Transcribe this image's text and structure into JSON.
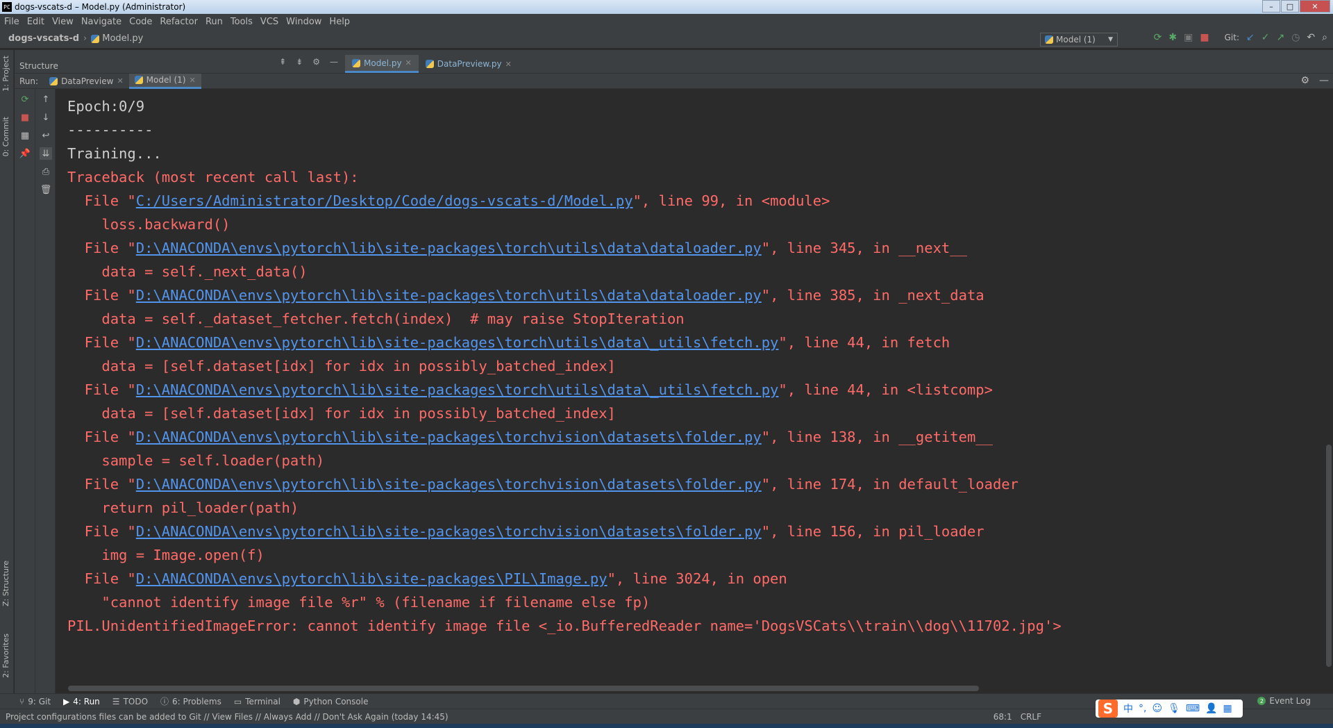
{
  "window": {
    "title": "dogs-vscats-d – Model.py (Administrator)",
    "app_icon": "PC",
    "controls": [
      "–",
      "□",
      "✕"
    ]
  },
  "menu": [
    "File",
    "Edit",
    "View",
    "Navigate",
    "Code",
    "Refactor",
    "Run",
    "Tools",
    "VCS",
    "Window",
    "Help"
  ],
  "nav": {
    "project": "dogs-vscats-d",
    "file": "Model.py",
    "run_config": "Model (1)",
    "git_label": "Git:"
  },
  "structure_panel": {
    "label": "Structure"
  },
  "editor_tabs": [
    {
      "label": "Model.py",
      "active": true
    },
    {
      "label": "DataPreview.py",
      "active": false
    }
  ],
  "run_panel": {
    "label": "Run:",
    "tabs": [
      {
        "label": "DataPreview",
        "active": false
      },
      {
        "label": "Model (1)",
        "active": true
      }
    ]
  },
  "left_vertical_tabs": {
    "project": "1: Project",
    "commit": "0: Commit",
    "structure": "Z: Structure",
    "favorites": "2: Favorites"
  },
  "console": {
    "lines": [
      {
        "type": "std",
        "text": "Epoch:0/9"
      },
      {
        "type": "std",
        "text": "----------"
      },
      {
        "type": "std",
        "text": "Training..."
      },
      {
        "type": "err",
        "text": "Traceback (most recent call last):"
      },
      {
        "type": "file",
        "pre": "  File \"",
        "path": "C:/Users/Administrator/Desktop/Code/dogs-vscats-d/Model.py",
        "post": "\", line 99, in <module>"
      },
      {
        "type": "err",
        "text": "    loss.backward()"
      },
      {
        "type": "file",
        "pre": "  File \"",
        "path": "D:\\ANACONDA\\envs\\pytorch\\lib\\site-packages\\torch\\utils\\data\\dataloader.py",
        "post": "\", line 345, in __next__"
      },
      {
        "type": "err",
        "text": "    data = self._next_data()"
      },
      {
        "type": "file",
        "pre": "  File \"",
        "path": "D:\\ANACONDA\\envs\\pytorch\\lib\\site-packages\\torch\\utils\\data\\dataloader.py",
        "post": "\", line 385, in _next_data"
      },
      {
        "type": "err",
        "text": "    data = self._dataset_fetcher.fetch(index)  # may raise StopIteration"
      },
      {
        "type": "file",
        "pre": "  File \"",
        "path": "D:\\ANACONDA\\envs\\pytorch\\lib\\site-packages\\torch\\utils\\data\\_utils\\fetch.py",
        "post": "\", line 44, in fetch"
      },
      {
        "type": "err",
        "text": "    data = [self.dataset[idx] for idx in possibly_batched_index]"
      },
      {
        "type": "file",
        "pre": "  File \"",
        "path": "D:\\ANACONDA\\envs\\pytorch\\lib\\site-packages\\torch\\utils\\data\\_utils\\fetch.py",
        "post": "\", line 44, in <listcomp>"
      },
      {
        "type": "err",
        "text": "    data = [self.dataset[idx] for idx in possibly_batched_index]"
      },
      {
        "type": "file",
        "pre": "  File \"",
        "path": "D:\\ANACONDA\\envs\\pytorch\\lib\\site-packages\\torchvision\\datasets\\folder.py",
        "post": "\", line 138, in __getitem__"
      },
      {
        "type": "err",
        "text": "    sample = self.loader(path)"
      },
      {
        "type": "file",
        "pre": "  File \"",
        "path": "D:\\ANACONDA\\envs\\pytorch\\lib\\site-packages\\torchvision\\datasets\\folder.py",
        "post": "\", line 174, in default_loader"
      },
      {
        "type": "err",
        "text": "    return pil_loader(path)"
      },
      {
        "type": "file",
        "pre": "  File \"",
        "path": "D:\\ANACONDA\\envs\\pytorch\\lib\\site-packages\\torchvision\\datasets\\folder.py",
        "post": "\", line 156, in pil_loader"
      },
      {
        "type": "err",
        "text": "    img = Image.open(f)"
      },
      {
        "type": "file",
        "pre": "  File \"",
        "path": "D:\\ANACONDA\\envs\\pytorch\\lib\\site-packages\\PIL\\Image.py",
        "post": "\", line 3024, in open"
      },
      {
        "type": "err",
        "text": "    \"cannot identify image file %r\" % (filename if filename else fp)"
      },
      {
        "type": "err",
        "text": "PIL.UnidentifiedImageError: cannot identify image file <_io.BufferedReader name='DogsVSCats\\\\train\\\\dog\\\\11702.jpg'>"
      }
    ]
  },
  "bottom_tabs": [
    {
      "label": "9: Git",
      "icon": "git-icon",
      "active": false
    },
    {
      "label": "4: Run",
      "icon": "run-icon",
      "active": true
    },
    {
      "label": "TODO",
      "icon": "todo-icon",
      "active": false
    },
    {
      "label": "6: Problems",
      "icon": "problems-icon",
      "active": false
    },
    {
      "label": "Terminal",
      "icon": "terminal-icon",
      "active": false
    },
    {
      "label": "Python Console",
      "icon": "python-icon",
      "active": false
    }
  ],
  "event_log": {
    "label": "Event Log",
    "count": "2"
  },
  "status": {
    "message": "Project configurations files can be added to Git // View Files // Always Add // Don't Ask Again (today 14:45)",
    "position": "68:1",
    "line_sep": "CRLF"
  },
  "ime": {
    "logo": "S",
    "lang": "中"
  },
  "colors": {
    "error_text": "#ff6b68",
    "link": "#5394ec",
    "std_text": "#cfcfcf",
    "background": "#2b2b2b",
    "panel": "#3c3f41",
    "accent": "#4a88c7"
  }
}
